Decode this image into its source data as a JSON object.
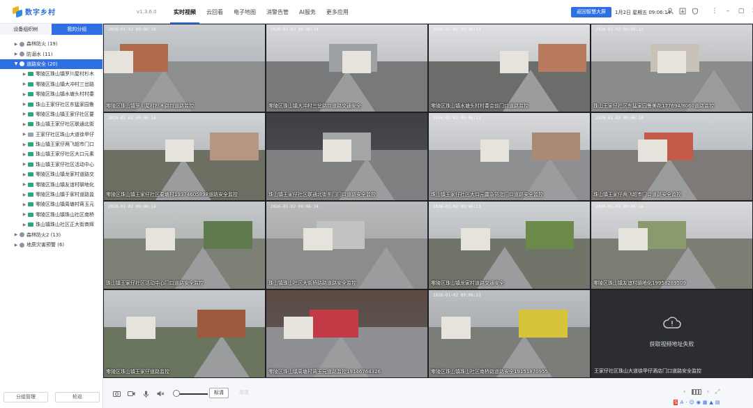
{
  "app": {
    "name": "数字乡村",
    "version": "v1.3.6.0"
  },
  "nav": [
    "实时视频",
    "云回看",
    "电子地图",
    "消警告管",
    "AI服务",
    "更多应用"
  ],
  "header": {
    "return_btn": "返回智慧大屏",
    "datetime": "1月2日 星期五 09:06:14"
  },
  "sidebar": {
    "tabs": [
      "设备组织树",
      "我的分组"
    ],
    "tree": [
      {
        "label": "森林防火 (19)",
        "level": 0,
        "type": "group",
        "open": false
      },
      {
        "label": "防溺水 (11)",
        "level": 0,
        "type": "group",
        "open": false
      },
      {
        "label": "道路安全 (20)",
        "level": 0,
        "type": "group",
        "open": true,
        "selected": true
      },
      {
        "label": "零陵区珠山镇罗川屋村杉木",
        "level": 1,
        "type": "camera"
      },
      {
        "label": "零陵区珠山镇大冲村三岔路",
        "level": 1,
        "type": "camera"
      },
      {
        "label": "零陵区珠山镇水塘头村村委",
        "level": 1,
        "type": "camera"
      },
      {
        "label": "珠山王家仔社区东猛家园鲁",
        "level": 1,
        "type": "camera"
      },
      {
        "label": "零陵区珠山镇王家仔社区要",
        "level": 1,
        "type": "camera"
      },
      {
        "label": "珠山镇王家仔社区联通北街",
        "level": 1,
        "type": "camera"
      },
      {
        "label": "王家仔社区珠山大道徐甲仔",
        "level": 1,
        "type": "camera",
        "offline": true
      },
      {
        "label": "珠山镇王家仔两飞超市门口",
        "level": 1,
        "type": "camera"
      },
      {
        "label": "珠山镇王家仔社区大口元素",
        "level": 1,
        "type": "camera"
      },
      {
        "label": "珠山镇王家仔社区活动中心",
        "level": 1,
        "type": "camera"
      },
      {
        "label": "零陵区珠山镇龙家村道路交",
        "level": 1,
        "type": "camera"
      },
      {
        "label": "零陵区珠山镇友谊村聊地化",
        "level": 1,
        "type": "camera"
      },
      {
        "label": "零陵区珠山镇于家村道路监",
        "level": 1,
        "type": "camera"
      },
      {
        "label": "零陵区珠山镇周塘村蒋玉元",
        "level": 1,
        "type": "camera"
      },
      {
        "label": "零陵区珠山镇珠山社区南桥",
        "level": 1,
        "type": "camera"
      },
      {
        "label": "珠山镇珠山社区正大街商辉",
        "level": 1,
        "type": "camera"
      },
      {
        "label": "森林防火2 (13)",
        "level": 0,
        "type": "group",
        "open": false
      },
      {
        "label": "地质灾害预警 (6)",
        "level": 0,
        "type": "group",
        "open": false
      }
    ],
    "footer": [
      "分组管理",
      "轮巡"
    ]
  },
  "tiles": [
    {
      "caption": "零陵区珠山镇罗川屋村杉木路口道路监控",
      "ts": "2026-01-02 09:06:14",
      "palette": [
        "#c9ccd0",
        "#8d8f8e",
        "#b26b4a"
      ]
    },
    {
      "caption": "零陵区珠山镇大冲村三岔路口道路交通安全",
      "ts": "2026-01-02 09:06:14",
      "palette": [
        "#d7d9dc",
        "#77797b",
        "#9ea1a3"
      ]
    },
    {
      "caption": "零陵区珠山镇水塘头村村委会前门口道路监控",
      "ts": "2026-01-02 09:06:13",
      "palette": [
        "#dfe1e3",
        "#6b6d6b",
        "#b77a5c"
      ]
    },
    {
      "caption": "珠山王家仔社区东猛家园鲁美花177694/8060道路监控",
      "ts": "2026-01-02 09:06:13",
      "palette": [
        "#d5d7da",
        "#8a8c8c",
        "#c7c1b8"
      ]
    },
    {
      "caption": "零陵区珠山镇王家仔社区要塘村19374605898道路安全监控",
      "ts": "2026-01-02 09:06:14",
      "palette": [
        "#d0d3d6",
        "#6c6f62",
        "#b59683"
      ]
    },
    {
      "caption": "珠山镇王家仔社区联通北街东门门口道路安全监控",
      "ts": "",
      "palette": [
        "#3d3f42",
        "#7e8081",
        "#a4a6a7"
      ]
    },
    {
      "caption": "珠山镇王家仔社区大口元露杂货店门口道路安全监控",
      "ts": "2026-01-02 09:06:13",
      "palette": [
        "#d8dadc",
        "#8d8f90",
        "#a98a76"
      ],
      "selected": true
    },
    {
      "caption": "珠山镇王家仔两飞超市门口道路安全监控",
      "ts": "2026-01-02 09:06:14",
      "palette": [
        "#cfd3d8",
        "#7f7a78",
        "#c45a4a"
      ]
    },
    {
      "caption": "珠山镇王家仔社区活动中心门口道路安全监控",
      "ts": "2026-01-02 09:06:14",
      "palette": [
        "#c6c9c9",
        "#7d8074",
        "#5f7a4e"
      ]
    },
    {
      "caption": "珠山镇珠山社区大街桥路路道路安全监控",
      "ts": "2026-01-02 09:06:14",
      "palette": [
        "#b9bbbc",
        "#8b8c8b",
        "#c0c2c3"
      ]
    },
    {
      "caption": "零陵区珠山镇龙家村道路交通安全",
      "ts": "2026-01-02 09:06:13",
      "palette": [
        "#cfd2d4",
        "#707469",
        "#6b8a4a"
      ]
    },
    {
      "caption": "零陵区珠山镇友谊村聊地化19958289509",
      "ts": "2026-01-02 09:06:14",
      "palette": [
        "#d8dadc",
        "#7c7e73",
        "#8a9a6c"
      ]
    },
    {
      "caption": "零陵区珠山镇王家仔道路监控",
      "ts": "",
      "palette": [
        "#c8cbcd",
        "#6a7560",
        "#9b5a3e"
      ]
    },
    {
      "caption": "零陵区珠山镇周塘村蒋玉元道路监控19146764326",
      "ts": "",
      "palette": [
        "#5a4a44",
        "#8e8f92",
        "#c23a46"
      ]
    },
    {
      "caption": "零陵区珠山镇珠山社区南桥路道路安全19151870955",
      "ts": "2026-01-02 09:06:13",
      "palette": [
        "#bcbfc1",
        "#7b7d78",
        "#d7c43a"
      ]
    },
    {
      "caption": "王家仔社区珠山大道徐甲仔酒店门口道路安全监控",
      "error": "获取视频地址失败"
    }
  ],
  "toolbar": {
    "standard": "标清",
    "disabled": "高清"
  }
}
